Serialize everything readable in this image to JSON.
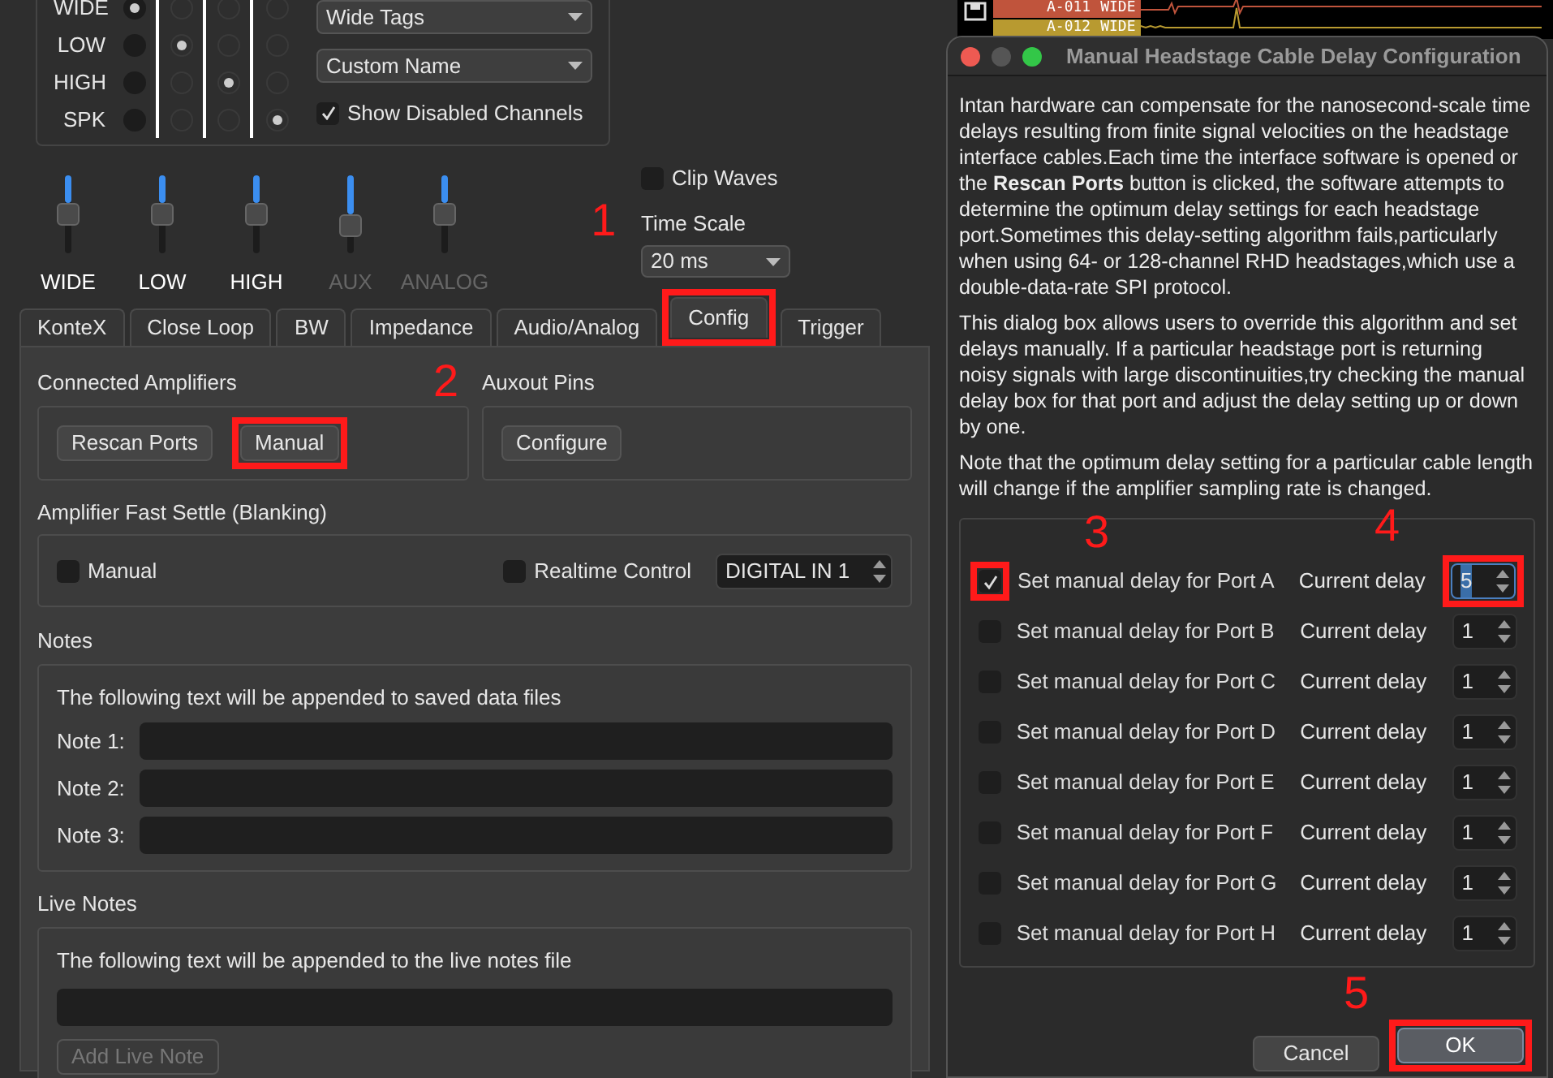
{
  "channel_display": {
    "rows": [
      {
        "label": "WIDE",
        "options": [
          {
            "selected": true
          },
          {
            "selected": false
          },
          {
            "selected": false
          },
          {
            "selected": false
          }
        ]
      },
      {
        "label": "LOW",
        "options": [
          {
            "selected": false
          },
          {
            "selected": true
          },
          {
            "selected": false
          },
          {
            "selected": false
          }
        ]
      },
      {
        "label": "HIGH",
        "options": [
          {
            "selected": false
          },
          {
            "selected": false
          },
          {
            "selected": true
          },
          {
            "selected": false
          }
        ]
      },
      {
        "label": "SPK",
        "options": [
          {
            "selected": false
          },
          {
            "selected": false
          },
          {
            "selected": false
          },
          {
            "selected": true
          }
        ]
      }
    ],
    "dropdowns": [
      "Wide Tags",
      "Custom Name"
    ],
    "show_disabled": {
      "label": "Show Disabled Channels",
      "checked": true
    }
  },
  "scale_sliders": [
    {
      "label": "WIDE",
      "level": 0.5,
      "disabled": false
    },
    {
      "label": "LOW",
      "level": 0.5,
      "disabled": false
    },
    {
      "label": "HIGH",
      "level": 0.5,
      "disabled": false
    },
    {
      "label": "AUX",
      "level": 0.3,
      "disabled": true
    },
    {
      "label": "ANALOG",
      "level": 0.5,
      "disabled": true
    }
  ],
  "clip_waves": {
    "label": "Clip Waves",
    "checked": false
  },
  "time_scale": {
    "label": "Time Scale",
    "value": "20 ms"
  },
  "tabs": [
    {
      "label": "KonteX",
      "selected": false
    },
    {
      "label": "Close Loop",
      "selected": false
    },
    {
      "label": "BW",
      "selected": false
    },
    {
      "label": "Impedance",
      "selected": false
    },
    {
      "label": "Audio/Analog",
      "selected": false
    },
    {
      "label": "Config",
      "selected": true,
      "callout": "1"
    },
    {
      "label": "Trigger",
      "selected": false
    }
  ],
  "config": {
    "connected_amplifiers": {
      "title": "Connected Amplifiers",
      "buttons": [
        {
          "label": "Rescan Ports"
        },
        {
          "label": "Manual",
          "callout": "2"
        }
      ]
    },
    "auxout_pins": {
      "title": "Auxout Pins",
      "buttons": [
        {
          "label": "Configure"
        }
      ]
    },
    "fast_settle": {
      "title": "Amplifier Fast Settle (Blanking)",
      "manual": {
        "label": "Manual",
        "checked": false
      },
      "realtime": {
        "label": "Realtime Control",
        "checked": false
      },
      "input": "DIGITAL IN 1"
    },
    "notes": {
      "title": "Notes",
      "text": "The following text will be appended to saved data files",
      "fields": [
        "Note 1:",
        "Note 2:",
        "Note 3:"
      ]
    },
    "live_notes": {
      "title": "Live Notes",
      "text": "The following text will be appended to the live notes file",
      "button": {
        "label": "Add Live Note",
        "disabled": true
      }
    }
  },
  "waveform_strip": {
    "channels": [
      {
        "name": "A-011",
        "tag": "WIDE",
        "color": "#c0543c"
      },
      {
        "name": "A-012",
        "tag": "WIDE",
        "color": "#b89a30"
      }
    ]
  },
  "dialog": {
    "title": "Manual Headstage Cable Delay Configuration",
    "paragraphs": [
      "Intan hardware can compensate for the nanosecond-scale time delays resulting from finite signal velocities on the headstage interface cables.Each time the interface software is opened or the **Rescan Ports** button is clicked, the software attempts to determine the optimum delay settings for each headstage port.Sometimes this delay-setting algorithm fails,particularly when using 64- or 128-channel RHD headstages,which use a double-data-rate SPI protocol.",
      "This dialog box allows users to override this algorithm and set delays manually. If a particular headstage port is returning noisy signals with large discontinuities,try checking the manual delay box for that port and adjust the delay setting up or down by one.",
      "Note that the optimum delay setting for a particular cable length will change if the amplifier sampling rate is changed."
    ],
    "ports": [
      {
        "label": "Set manual delay for Port A",
        "checked": true,
        "delay_label": "Current delay",
        "value": "5",
        "focused": true,
        "check_callout": "3",
        "value_callout": "4"
      },
      {
        "label": "Set manual delay for Port B",
        "checked": false,
        "delay_label": "Current delay",
        "value": "1",
        "focused": false
      },
      {
        "label": "Set manual delay for Port C",
        "checked": false,
        "delay_label": "Current delay",
        "value": "1",
        "focused": false
      },
      {
        "label": "Set manual delay for Port D",
        "checked": false,
        "delay_label": "Current delay",
        "value": "1",
        "focused": false
      },
      {
        "label": "Set manual delay for Port E",
        "checked": false,
        "delay_label": "Current delay",
        "value": "1",
        "focused": false
      },
      {
        "label": "Set manual delay for Port F",
        "checked": false,
        "delay_label": "Current delay",
        "value": "1",
        "focused": false
      },
      {
        "label": "Set manual delay for Port G",
        "checked": false,
        "delay_label": "Current delay",
        "value": "1",
        "focused": false
      },
      {
        "label": "Set manual delay for Port H",
        "checked": false,
        "delay_label": "Current delay",
        "value": "1",
        "focused": false
      }
    ],
    "buttons": [
      {
        "label": "Cancel",
        "default": false
      },
      {
        "label": "OK",
        "default": true,
        "callout": "5"
      }
    ]
  }
}
